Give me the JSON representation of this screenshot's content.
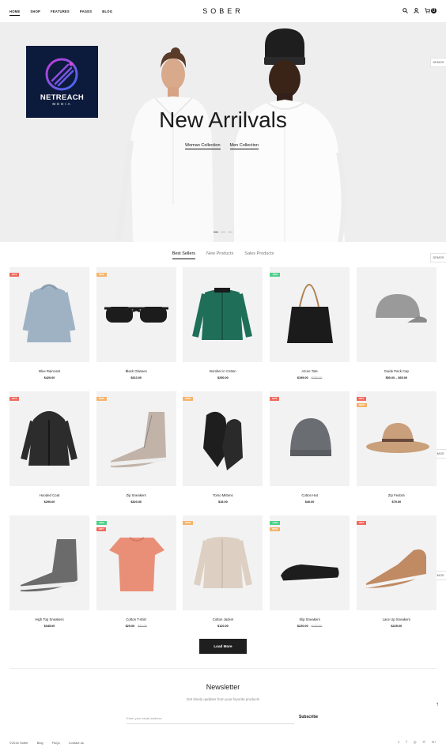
{
  "header": {
    "logo": "SOBER",
    "nav": [
      "HOME",
      "SHOP",
      "FEATURES",
      "PAGES",
      "BLOG"
    ],
    "cart_count": "0",
    "icons": [
      "search-icon",
      "user-icon",
      "cart-icon"
    ]
  },
  "watermark": {
    "name": "NETREACH",
    "sub": "MEDIA"
  },
  "hero": {
    "title": "New Arrilvals",
    "links": [
      "Woman Collection",
      "Men Collection"
    ]
  },
  "demos_label": "DEMOS",
  "tabs": [
    "Best Sellers",
    "New Products",
    "Sales Products"
  ],
  "products": [
    {
      "name": "Blue Raincoat",
      "price": "$420.00",
      "old": "",
      "badges": [
        "HOT"
      ]
    },
    {
      "name": "Black Glasses",
      "price": "$310.00",
      "old": "",
      "badges": [
        "NEW"
      ]
    },
    {
      "name": "Bomber in Cotton",
      "price": "$250.00",
      "old": "",
      "badges": []
    },
    {
      "name": "Azure Tote",
      "price": "$199.00",
      "old": "$260.00",
      "badges": [
        "-20%"
      ]
    },
    {
      "name": "Guide Pack Cap",
      "price": "$50.00 – $65.00",
      "old": "",
      "badges": []
    },
    {
      "name": "Hooded Coat",
      "price": "$290.00",
      "old": "",
      "badges": [
        "HOT"
      ]
    },
    {
      "name": "Zip Sneakers",
      "price": "$320.00",
      "old": "",
      "badges": [
        "NEW"
      ]
    },
    {
      "name": "Torso Mittens",
      "price": "$15.00",
      "old": "",
      "badges": [
        "NEW"
      ]
    },
    {
      "name": "Cotton Hat",
      "price": "$40.00",
      "old": "",
      "badges": [
        "HOT"
      ]
    },
    {
      "name": "Zip Fedora",
      "price": "$75.00",
      "old": "",
      "badges": [
        "HOT",
        "NEW"
      ]
    },
    {
      "name": "High Top Sneakers",
      "price": "$345.00",
      "old": "",
      "badges": []
    },
    {
      "name": "Cotton T-shirt",
      "price": "$25.00",
      "old": "$34.00",
      "badges": [
        "-20%",
        "HOT"
      ]
    },
    {
      "name": "Cotton Jacket",
      "price": "$120.00",
      "old": "",
      "badges": [
        "NEW"
      ]
    },
    {
      "name": "Slip Sneakers",
      "price": "$220.00",
      "old": "$275.00",
      "badges": [
        "-15%",
        "NEW"
      ]
    },
    {
      "name": "Lace Up Sneakers",
      "price": "$225.00",
      "old": "",
      "badges": [
        "HOT"
      ]
    }
  ],
  "load_more": "Load More",
  "newsletter": {
    "title": "Newsletter",
    "subtitle": "Get timely updates from your favorite products",
    "placeholder": "Enter your email address",
    "button": "Subscribe"
  },
  "to_top": "↑",
  "footer": {
    "copyright": "©2016 Sober",
    "links": [
      "Blog",
      "FAQs",
      "Contact us"
    ],
    "social": [
      "twitter-icon",
      "facebook-icon",
      "instagram-icon",
      "pinterest-icon",
      "google-plus-icon"
    ]
  },
  "colors": {
    "hot": "#f0695c",
    "new": "#f5b36a",
    "sale": "#4dd08a",
    "watermark_bg": "#0c1a3b"
  }
}
